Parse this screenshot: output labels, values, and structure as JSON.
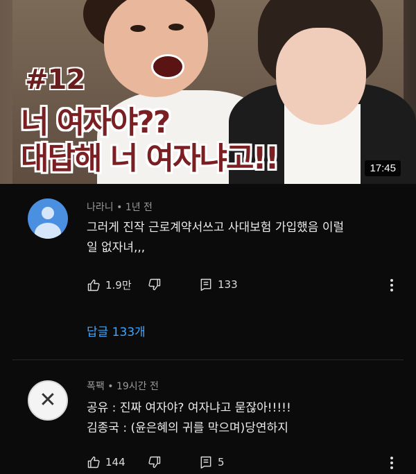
{
  "video": {
    "episode": "#12",
    "title_line1": "너 여자야??",
    "title_line2": "대답해 너 여자냐고!!",
    "duration": "17:45"
  },
  "comments": [
    {
      "author": "나라니",
      "time": "1년 전",
      "lines": [
        "그러게 진작 근로계약서쓰고 사대보험 가입했음 이럴",
        "일 없자녀,,,"
      ],
      "likes": "1.9만",
      "reply_count": "133",
      "replies_label": "답글 133개",
      "avatar_icon": "default-user-avatar-icon"
    },
    {
      "author": "폭팩",
      "time": "19시간 전",
      "lines": [
        "공유 : 진짜 여자야? 여자냐고 묻잖아!!!!!",
        "김종국 : (윤은혜의 귀를 막으며)당연하지"
      ],
      "likes": "144",
      "reply_count": "5",
      "avatar_icon": "x-mark-avatar-icon"
    }
  ],
  "colors": {
    "background": "#0b0b0b",
    "link": "#3ea6ff",
    "thumb_title": "#7a1f22"
  }
}
